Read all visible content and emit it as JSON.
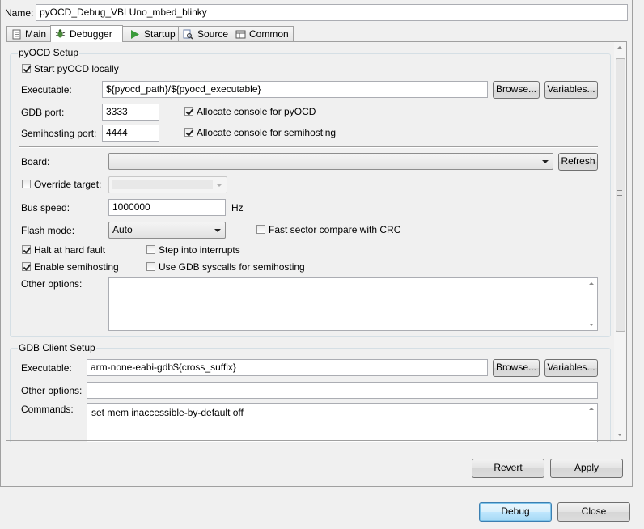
{
  "name_label": "Name:",
  "name_value": "pyOCD_Debug_VBLUno_mbed_blinky",
  "tabs": [
    {
      "label": "Main",
      "icon": "main-tab-icon"
    },
    {
      "label": "Debugger",
      "icon": "debugger-bug-icon"
    },
    {
      "label": "Startup",
      "icon": "startup-play-icon"
    },
    {
      "label": "Source",
      "icon": "source-icon"
    },
    {
      "label": "Common",
      "icon": "common-icon"
    }
  ],
  "pyocd": {
    "group_title": "pyOCD Setup",
    "start_locally_label": "Start pyOCD locally",
    "start_locally_checked": true,
    "executable_label": "Executable:",
    "executable_value": "${pyocd_path}/${pyocd_executable}",
    "browse_label": "Browse...",
    "variables_label": "Variables...",
    "gdb_port_label": "GDB port:",
    "gdb_port_value": "3333",
    "alloc_console_label": "Allocate console for pyOCD",
    "alloc_console_checked": true,
    "semihost_port_label": "Semihosting port:",
    "semihost_port_value": "4444",
    "alloc_semihost_label": "Allocate console for semihosting",
    "alloc_semihost_checked": true,
    "board_label": "Board:",
    "board_value": "",
    "refresh_label": "Refresh",
    "override_label": "Override target:",
    "override_checked": false,
    "override_value": "",
    "bus_speed_label": "Bus speed:",
    "bus_speed_value": "1000000",
    "bus_speed_unit": "Hz",
    "flash_mode_label": "Flash mode:",
    "flash_mode_value": "Auto",
    "fast_sector_label": "Fast sector compare with CRC",
    "fast_sector_checked": false,
    "halt_label": "Halt at hard fault",
    "halt_checked": true,
    "step_label": "Step into interrupts",
    "step_checked": false,
    "enable_semi_label": "Enable semihosting",
    "enable_semi_checked": true,
    "gdb_syscalls_label": "Use GDB syscalls for semihosting",
    "gdb_syscalls_checked": false,
    "other_options_label": "Other options:",
    "other_options_value": ""
  },
  "gdb": {
    "group_title": "GDB Client Setup",
    "executable_label": "Executable:",
    "executable_value": "arm-none-eabi-gdb${cross_suffix}",
    "browse_label": "Browse...",
    "variables_label": "Variables...",
    "other_options_label": "Other options:",
    "other_options_value": "",
    "commands_label": "Commands:",
    "commands_value": "set mem inaccessible-by-default off"
  },
  "buttons": {
    "revert": "Revert",
    "apply": "Apply",
    "debug": "Debug",
    "close": "Close"
  },
  "colors": {
    "window_bg": "#f0f0f0",
    "default_button": "#3c7fb1"
  }
}
